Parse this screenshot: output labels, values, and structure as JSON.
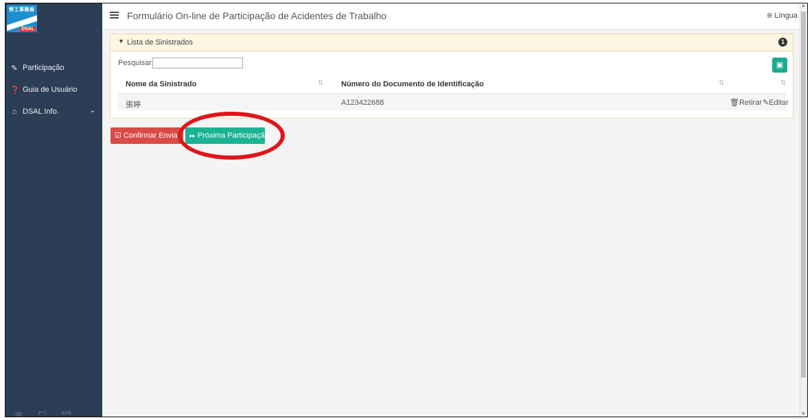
{
  "header": {
    "title": "Formulário On-line de Participação de Acidentes de Trabalho",
    "language_label": "Língua"
  },
  "logo": {
    "cn_text": "勞工事務局",
    "brand": "DSAL"
  },
  "sidebar": {
    "items": [
      {
        "label": "Participação",
        "icon": "edit-icon"
      },
      {
        "label": "Guia de Usuário",
        "icon": "question-circle-icon"
      },
      {
        "label": "DSAL Info.",
        "icon": "home-icon"
      }
    ],
    "languages": [
      "中",
      "PT",
      "EN"
    ]
  },
  "panel": {
    "title": "Lista de Sinistrados",
    "badge_count": "1",
    "search_label": "Pesquisar:",
    "search_value": "",
    "columns": [
      "Nome da Sinistrado",
      "Número do Documento de Identificação"
    ],
    "rows": [
      {
        "name": "張婷",
        "document": "A123422688"
      }
    ],
    "actions": {
      "remove": "Retirar",
      "edit": "Editar"
    }
  },
  "buttons": {
    "confirm": "Confirmar Enviar",
    "next": "Próxima Participação"
  },
  "colors": {
    "sidebar_bg": "#2c3e55",
    "panel_header_bg": "#fcf6e2",
    "confirm_btn": "#d94b46",
    "next_btn": "#1cb394",
    "highlight_ring": "#e0161a"
  }
}
